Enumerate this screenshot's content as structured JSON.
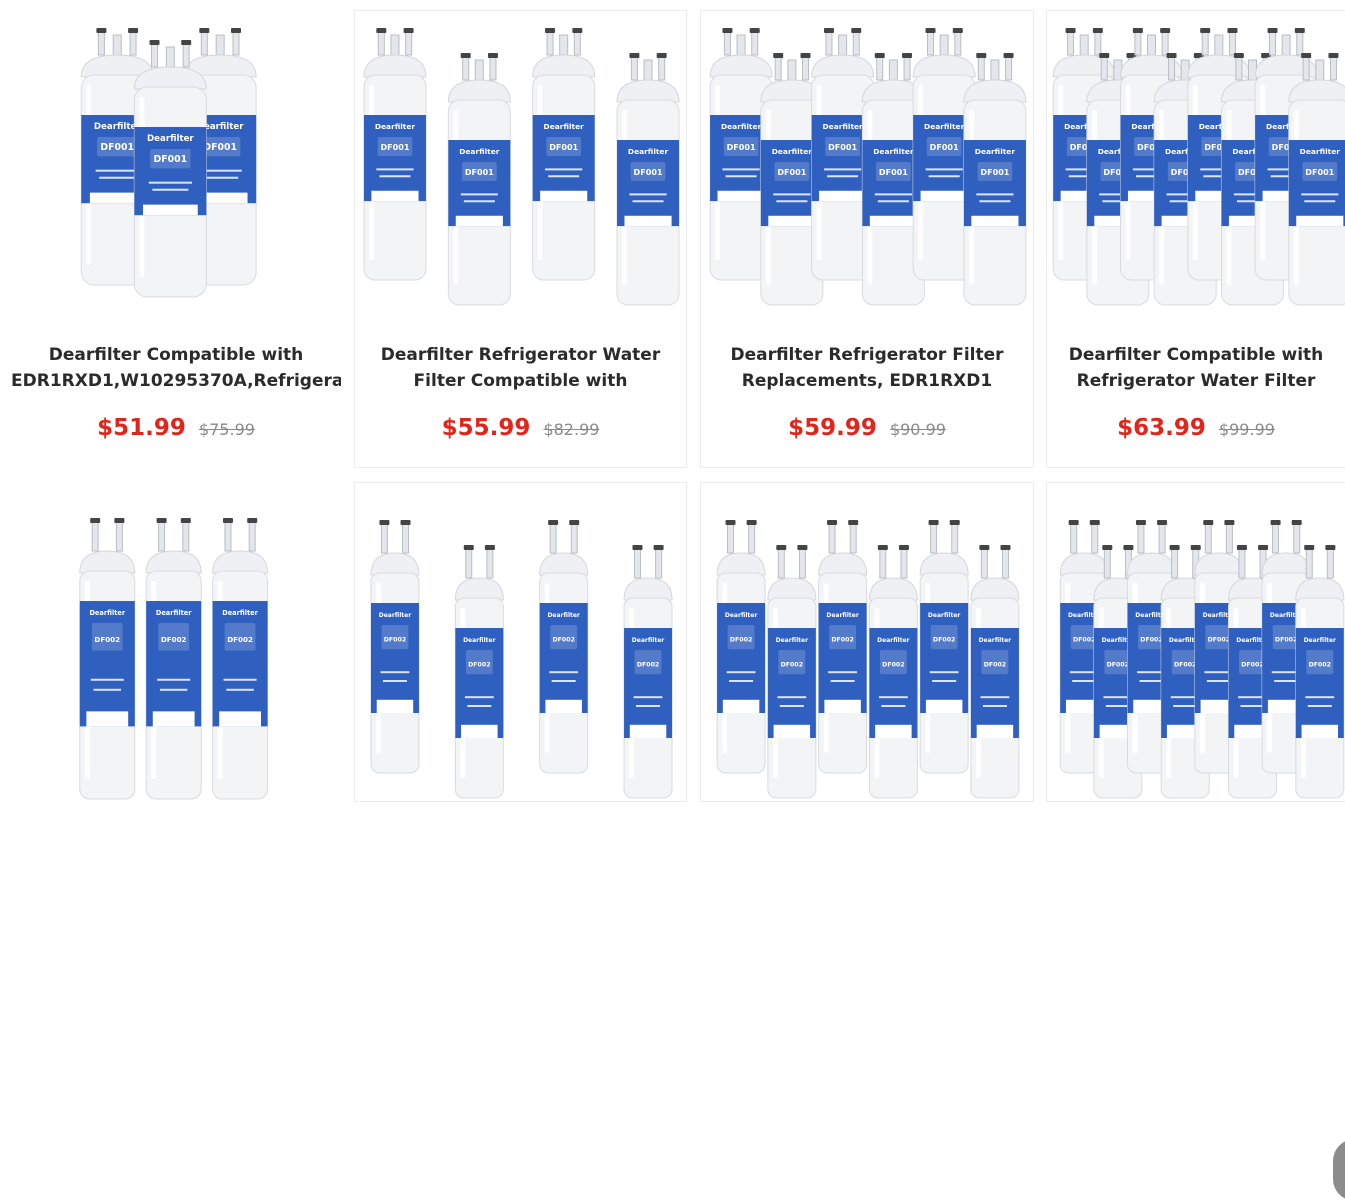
{
  "products": [
    {
      "title_lines": [
        "Dearfilter Compatible with",
        "EDR1RXD1,W10295370A,Refrigera"
      ],
      "sale_price": "$51.99",
      "regular_price": "$75.99",
      "image": {
        "type": "filter-bottles",
        "model": "DF001",
        "brand": "Dearfilter",
        "count": 3
      }
    },
    {
      "title_lines": [
        "Dearfilter Refrigerator Water",
        "Filter Compatible with"
      ],
      "sale_price": "$55.99",
      "regular_price": "$82.99",
      "image": {
        "type": "filter-bottles",
        "model": "DF001",
        "brand": "Dearfilter",
        "count": 4
      }
    },
    {
      "title_lines": [
        "Dearfilter Refrigerator Filter",
        "Replacements, EDR1RXD1"
      ],
      "sale_price": "$59.99",
      "regular_price": "$90.99",
      "image": {
        "type": "filter-bottles",
        "model": "DF001",
        "brand": "Dearfilter",
        "count": 6
      }
    },
    {
      "title_lines": [
        "Dearfilter Compatible with",
        "Refrigerator Water Filter"
      ],
      "sale_price": "$63.99",
      "regular_price": "$99.99",
      "image": {
        "type": "filter-bottles",
        "model": "DF001",
        "brand": "Dearfilter",
        "count": 8
      }
    },
    {
      "image": {
        "type": "filter-bottles",
        "model": "DF002",
        "brand": "Dearfilter",
        "count": 3
      }
    },
    {
      "image": {
        "type": "filter-bottles",
        "model": "DF002",
        "brand": "Dearfilter",
        "count": 4
      }
    },
    {
      "image": {
        "type": "filter-bottles",
        "model": "DF002",
        "brand": "Dearfilter",
        "count": 6
      }
    },
    {
      "image": {
        "type": "filter-bottles",
        "model": "DF002",
        "brand": "Dearfilter",
        "count": 8
      }
    }
  ],
  "colors": {
    "sale_price": "#e0261c",
    "regular_price": "#8a8a8a",
    "title": "#2b2b2b",
    "label_blue": "#2f5fbf",
    "card_border": "#ececec"
  }
}
